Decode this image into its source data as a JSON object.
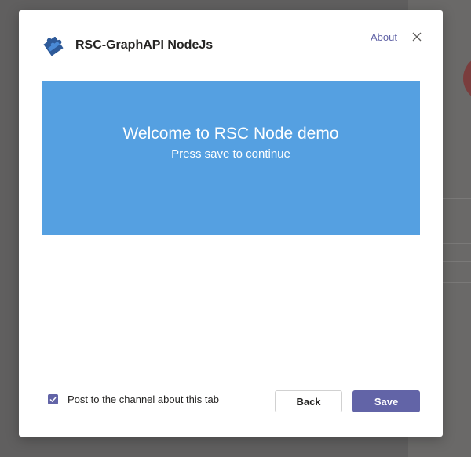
{
  "colors": {
    "accent": "#6264a7",
    "banner_background": "#55a0e1",
    "backdrop": "#605f5f",
    "dialog_background": "#ffffff"
  },
  "header": {
    "app_icon": "puzzle-piece-icon",
    "title": "RSC-GraphAPI NodeJs",
    "about_label": "About",
    "close_icon": "close-icon"
  },
  "banner": {
    "heading": "Welcome to RSC Node demo",
    "subheading": "Press save to continue"
  },
  "footer": {
    "post_checkbox_checked": true,
    "post_checkbox_label": "Post to the channel about this tab",
    "back_label": "Back",
    "save_label": "Save"
  }
}
